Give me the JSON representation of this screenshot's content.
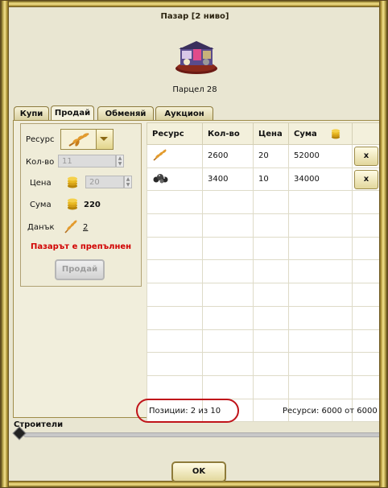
{
  "window": {
    "title": "Пазар [2 ниво]",
    "parcel": "Парцел 28"
  },
  "tabs": [
    {
      "label": "Купи"
    },
    {
      "label": "Продай"
    },
    {
      "label": "Обменяй"
    },
    {
      "label": "Аукцион"
    }
  ],
  "sell_form": {
    "resource_label": "Ресурс",
    "qty_label": "Кол-во",
    "qty_value": "11",
    "price_label": "Цена",
    "price_value": "20",
    "sum_label": "Сума",
    "sum_value": "220",
    "tax_label": "Данък",
    "tax_value": "2",
    "warning": "Пазарът е препълнен",
    "sell_button": "Продай"
  },
  "table": {
    "headers": [
      "Ресурс",
      "Кол-во",
      "Цена",
      "Сума"
    ],
    "rows": [
      {
        "resource_icon": "wheat-icon",
        "qty": "2600",
        "price": "20",
        "sum": "52000",
        "remove": "x"
      },
      {
        "resource_icon": "ore-icon",
        "qty": "3400",
        "price": "10",
        "sum": "34000",
        "remove": "x"
      }
    ]
  },
  "footer": {
    "positions": "Позиции: 2 из 10",
    "resources": "Ресурси: 6000 от 6000",
    "builders_label": "Строители",
    "ok": "OK"
  },
  "colors": {
    "warning": "#d10000",
    "highlight_ring": "#c0141a",
    "frame_gold": "#c7b357"
  }
}
